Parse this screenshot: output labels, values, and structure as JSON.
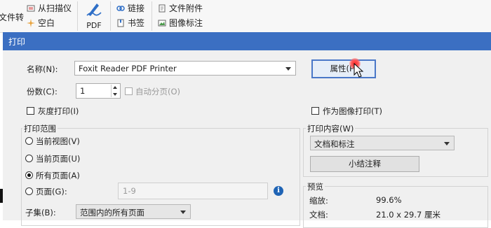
{
  "ribbon": {
    "scan_label": "从扫描仪",
    "blank_label": "空白",
    "file_convert_label": "文件转",
    "pdf_label": "PDF",
    "link_label": "链接",
    "bookmark_label": "书签",
    "attachment_label": "文件附件",
    "image_annot_label": "图像标注"
  },
  "dialog": {
    "title": "打印",
    "name_label": "名称(N):",
    "printer_value": "Foxit Reader PDF Printer",
    "properties_button": "属性(P)",
    "copies_label": "份数(C):",
    "copies_value": "1",
    "collate_label": "自动分页(O)",
    "grayscale_label": "灰度打印(I)",
    "print_as_image_label": "作为图像打印(T)",
    "range": {
      "title": "打印范围",
      "current_view": "当前视图(V)",
      "current_page": "当前页面(U)",
      "all_pages": "所有页面(A)",
      "pages": "页面(G):",
      "pages_value": "1-9",
      "subset_label": "子集(B):",
      "subset_value": "范围内的所有页面"
    },
    "content": {
      "title": "打印内容(W)",
      "value": "文档和标注",
      "summary_button": "小结注释"
    },
    "preview": {
      "title": "预览",
      "zoom_label": "缩放:",
      "zoom_value": "99.6%",
      "doc_label": "文档:",
      "doc_value": "21.0 x 29.7 厘米"
    }
  },
  "colors": {
    "titlebar": "#3b6fc2",
    "focus_border": "#4a78c8",
    "info_icon": "#1f64b5"
  }
}
